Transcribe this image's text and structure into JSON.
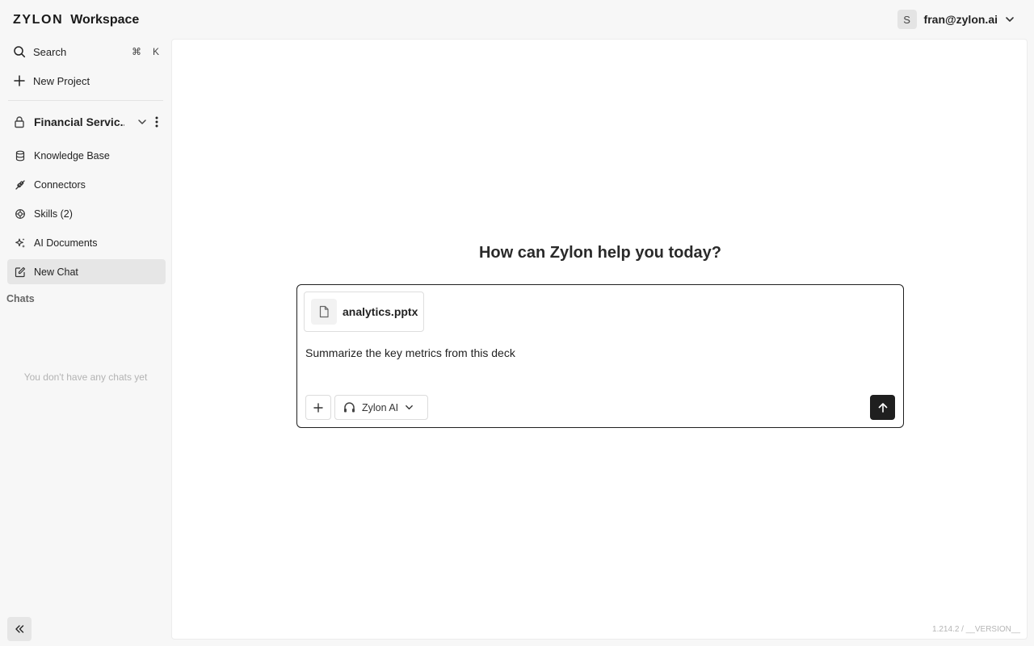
{
  "header": {
    "logo_text": "ZYLON",
    "app_name": "Workspace",
    "user": {
      "avatar_initial": "S",
      "email": "fran@zylon.ai"
    }
  },
  "sidebar": {
    "search": {
      "label": "Search",
      "shortcut_mod": "⌘",
      "shortcut_key": "K"
    },
    "new_project_label": "New Project",
    "project": {
      "name": "Financial Servic..."
    },
    "items": [
      {
        "label": "Knowledge Base",
        "icon": "database-icon"
      },
      {
        "label": "Connectors",
        "icon": "plug-icon"
      },
      {
        "label": "Skills (2)",
        "icon": "skills-icon"
      },
      {
        "label": "AI Documents",
        "icon": "sparkles-icon"
      },
      {
        "label": "New Chat",
        "icon": "new-chat-icon",
        "active": true
      }
    ],
    "chats_section_label": "Chats",
    "empty_chats_text": "You don't have any chats yet"
  },
  "main": {
    "headline": "How can Zylon help you today?",
    "composer": {
      "attachment_name": "analytics.pptx",
      "prompt_value": "Summarize the key metrics from this deck",
      "model_label": "Zylon AI"
    },
    "version_text": "1.214.2 / __VERSION__"
  },
  "colors": {
    "background": "#f7f7f7",
    "active_item": "#e6e6e6",
    "primary_button": "#1f1f1f"
  }
}
